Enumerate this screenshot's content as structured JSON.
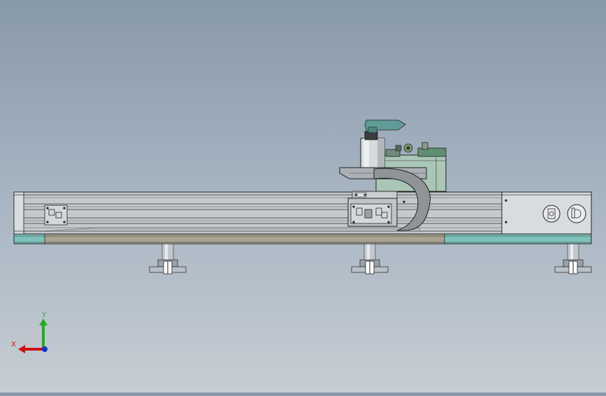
{
  "triad": {
    "x_label": "X",
    "y_label": "Y",
    "x_color": "#cc1111",
    "y_color": "#22aa22",
    "z_color": "#1133cc"
  },
  "colors": {
    "background_top": "#8899aa",
    "background_bottom": "#c6cdd4",
    "rail_body": "#c4c9ce",
    "rail_edge": "#3a3a3a",
    "base_teal": "#7ec3bb",
    "base_tan": "#a7a391",
    "carriage_green": "#a9c6b6",
    "handle_teal": "#5f9c97",
    "chain_gray": "#8f9497",
    "foot_metal": "#b5bcc4"
  }
}
